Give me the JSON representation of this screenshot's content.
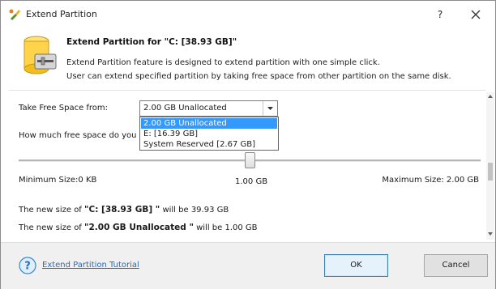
{
  "window": {
    "title": "Extend Partition",
    "help_glyph": "?",
    "close_icon": "close-icon"
  },
  "header": {
    "title": "Extend Partition for \"C: [38.93 GB]\"",
    "desc_line1": "Extend Partition feature is designed to extend partition with one simple click.",
    "desc_line2": "User can extend specified partition by taking free space from other partition on the same disk.",
    "icon": "disk-drive-icon"
  },
  "take_free_space": {
    "label": "Take Free Space from:",
    "selected": "2.00 GB Unallocated",
    "options": [
      "2.00 GB Unallocated",
      "E:  [16.39 GB]",
      "System Reserved [2.67 GB]"
    ]
  },
  "how_much": {
    "label": "How much free space do you wa"
  },
  "slider": {
    "min_label": "Minimum Size:0 KB",
    "current_label": "1.00 GB",
    "max_label": "Maximum Size: 2.00 GB",
    "value_fraction": 0.5
  },
  "results": {
    "line1_prefix": "The new size of ",
    "line1_name": "\"C: [38.93 GB] \"",
    "line1_suffix": " will be 39.93 GB",
    "line2_prefix": "The new size of ",
    "line2_name": "\"2.00 GB Unallocated \"",
    "line2_suffix": " will be 1.00 GB"
  },
  "footer": {
    "tutorial_link": "Extend Partition Tutorial",
    "ok_label": "OK",
    "cancel_label": "Cancel"
  },
  "colors": {
    "link": "#2a6ab8",
    "selection": "#3399ff",
    "accent_border": "#3c7fb1"
  }
}
